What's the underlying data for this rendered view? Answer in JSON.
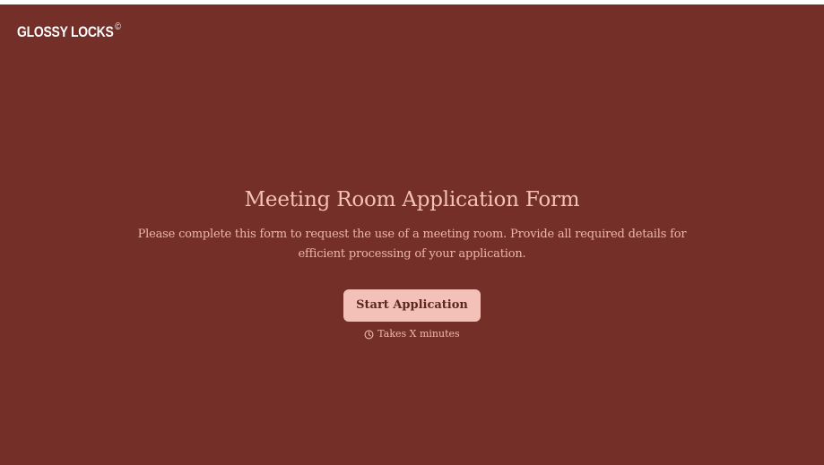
{
  "brand": {
    "name": "GLOSSY LOCKS",
    "mark": "©"
  },
  "hero": {
    "title": "Meeting Room Application Form",
    "description": "Please complete this form to request the use of a meeting room. Provide all required details for efficient processing of your application.",
    "start_button_label": "Start Application",
    "duration_text": "Takes X minutes",
    "duration_icon": "clock-icon"
  },
  "colors": {
    "background": "#732f28",
    "accent": "#f4c1b8",
    "button_text": "#5d2621"
  }
}
